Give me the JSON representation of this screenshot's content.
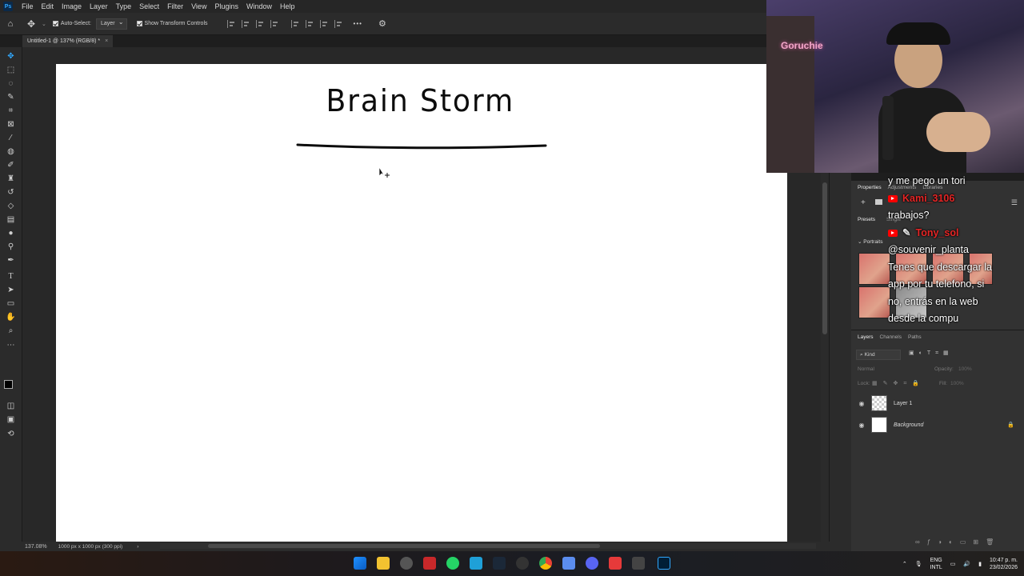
{
  "menubar": {
    "logo": "Ps",
    "items": [
      "File",
      "Edit",
      "Image",
      "Layer",
      "Type",
      "Select",
      "Filter",
      "View",
      "Plugins",
      "Window",
      "Help"
    ]
  },
  "options": {
    "auto_select_label": "Auto-Select:",
    "auto_select_value": "Layer",
    "transform_label": "Show Transform Controls",
    "more": "•••"
  },
  "document": {
    "tab_title": "Untitled-1 @ 137% (RGB/8) *",
    "close": "×",
    "canvas_title": "Brain Storm"
  },
  "status": {
    "zoom": "137.08%",
    "doc_info": "1000 px x 1000 px (300 ppi)",
    "arrow": "›"
  },
  "properties": {
    "tabs": [
      "Properties",
      "Adjustments",
      "Libraries"
    ],
    "subtabs": [
      "Presets",
      "Single"
    ],
    "group": "Portraits"
  },
  "layers": {
    "tabs": [
      "Layers",
      "Channels",
      "Paths"
    ],
    "filter": "Kind",
    "blend_mode": "Normal",
    "opacity_label": "Opacity:",
    "opacity": "100%",
    "lock_label": "Lock:",
    "fill_label": "Fill:",
    "fill": "100%",
    "items": [
      {
        "name": "Layer 1"
      },
      {
        "name": "Background"
      }
    ]
  },
  "chat": {
    "messages": [
      {
        "type": "text",
        "text": "y me pego un tori"
      },
      {
        "type": "user",
        "text": "Kami_3106"
      },
      {
        "type": "text",
        "text": "trabajos?"
      },
      {
        "type": "user",
        "text": "Tony_sol"
      },
      {
        "type": "text",
        "text": "@souvenir_planta"
      },
      {
        "type": "text",
        "text": "Tenes que descargar la"
      },
      {
        "type": "text",
        "text": "app por tu telefono, si"
      },
      {
        "type": "text",
        "text": "no, entrás en la web"
      },
      {
        "type": "text",
        "text": "desde la compu"
      }
    ]
  },
  "webcam": {
    "neon_sign": "Goruchie"
  },
  "tray": {
    "lang1": "ENG",
    "lang2": "INTL",
    "time": "10:47 p. m.",
    "date": "23/02/2026"
  },
  "colors": {
    "accent": "#31a8ff",
    "chat_user": "#e52525",
    "youtube": "#ff0000"
  }
}
